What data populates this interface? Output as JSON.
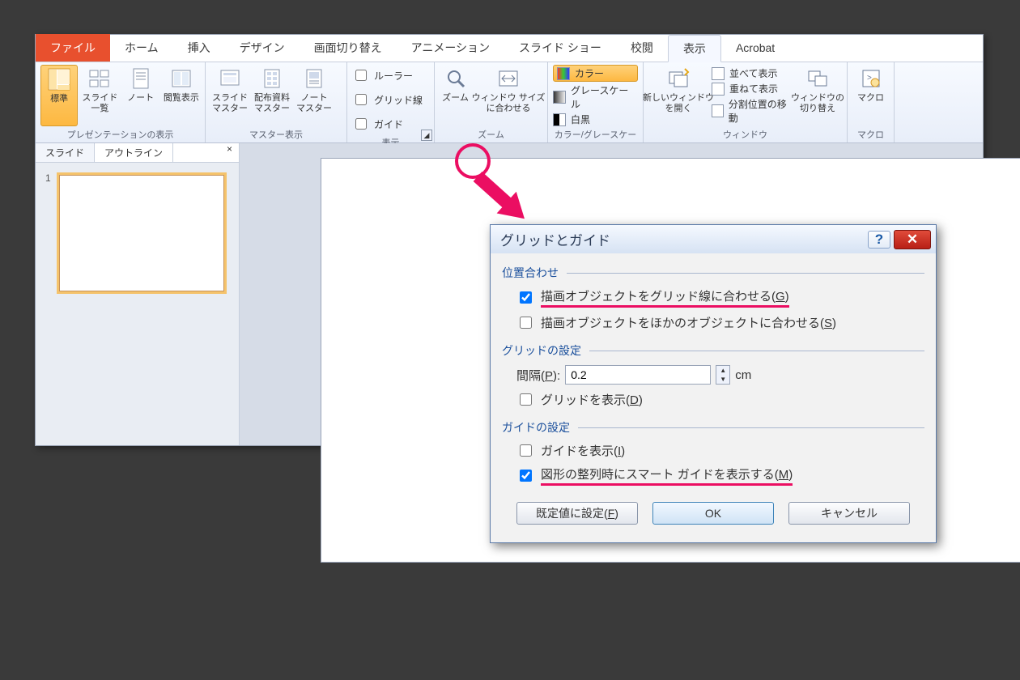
{
  "tabs": {
    "file": "ファイル",
    "home": "ホーム",
    "insert": "挿入",
    "design": "デザイン",
    "transition": "画面切り替え",
    "animation": "アニメーション",
    "slideshow": "スライド ショー",
    "review": "校閲",
    "view": "表示",
    "acrobat": "Acrobat"
  },
  "group_presviews": {
    "title": "プレゼンテーションの表示",
    "normal": "標準",
    "sorter": "スライド\n一覧",
    "notes": "ノート",
    "reading": "閲覧表示"
  },
  "group_master": {
    "title": "マスター表示",
    "slide": "スライド\nマスター",
    "handout": "配布資料\nマスター",
    "notes": "ノート\nマスター"
  },
  "group_show": {
    "title": "表示",
    "ruler": "ルーラー",
    "gridlines": "グリッド線",
    "guides": "ガイド"
  },
  "group_zoom": {
    "title": "ズーム",
    "zoom": "ズーム",
    "fit": "ウィンドウ サイズ\nに合わせる"
  },
  "group_color": {
    "title": "カラー/グレースケール",
    "color": "カラー",
    "gray": "グレースケール",
    "bw": "白黒"
  },
  "group_window": {
    "title": "ウィンドウ",
    "newwin": "新しいウィンドウ\nを開く",
    "arrange": "並べて表示",
    "cascade": "重ねて表示",
    "split": "分割位置の移動",
    "switch": "ウィンドウの\n切り替え"
  },
  "group_macro": {
    "title": "マクロ",
    "macro": "マクロ"
  },
  "side": {
    "slides": "スライド",
    "outline": "アウトライン",
    "close": "×",
    "num": "1"
  },
  "dialog": {
    "title": "グリッドとガイド",
    "fs_align": "位置合わせ",
    "snap_grid": "描画オブジェクトをグリッド線に合わせる(",
    "snap_grid_k": "G",
    "snap_grid_end": ")",
    "snap_obj": "描画オブジェクトをほかのオブジェクトに合わせる(",
    "snap_obj_k": "S",
    "snap_obj_end": ")",
    "fs_grid": "グリッドの設定",
    "spacing_lbl": "間隔(",
    "spacing_k": "P",
    "spacing_end": "):",
    "spacing_val": "0.2",
    "spacing_unit": "cm",
    "show_grid": "グリッドを表示(",
    "show_grid_k": "D",
    "show_grid_end": ")",
    "fs_guide": "ガイドの設定",
    "show_guide": "ガイドを表示(",
    "show_guide_k": "I",
    "show_guide_end": ")",
    "smart": "図形の整列時にスマート ガイドを表示する(",
    "smart_k": "M",
    "smart_end": ")",
    "default": "既定値に設定(",
    "default_k": "F",
    "default_end": ")",
    "ok": "OK",
    "cancel": "キャンセル",
    "help": "?",
    "x": "✕"
  }
}
